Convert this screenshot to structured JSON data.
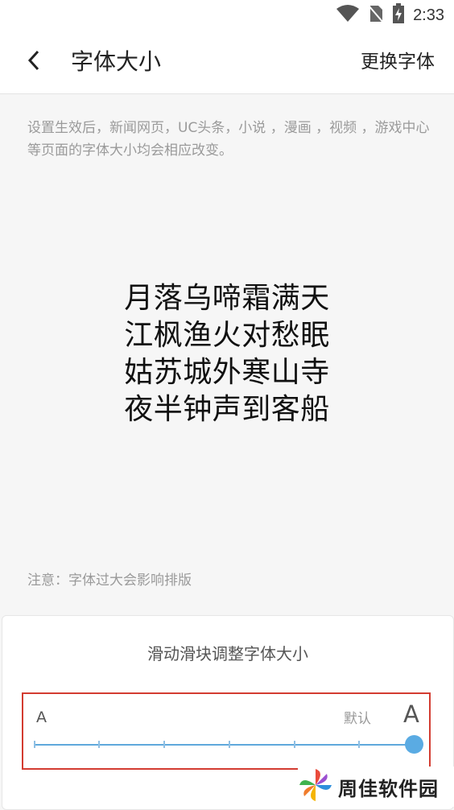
{
  "status_bar": {
    "time": "2:33",
    "icons": [
      "wifi-icon",
      "no-sim-icon",
      "battery-charging-icon"
    ]
  },
  "app_bar": {
    "back_icon": "chevron-left-icon",
    "title": "字体大小",
    "action_label": "更换字体"
  },
  "description": "设置生效后，新闻网页，UC头条，小说 ，漫画 ，视频 ，游戏中心等页面的字体大小均会相应改变。",
  "preview_poem": [
    "月落乌啼霜满天",
    "江枫渔火对愁眠",
    "姑苏城外寒山寺",
    "夜半钟声到客船"
  ],
  "note": "注意：字体过大会影响排版",
  "slider_panel": {
    "title": "滑动滑块调整字体大小",
    "small_label": "A",
    "default_label": "默认",
    "large_label": "A",
    "steps": 7,
    "selected_step": 7
  },
  "watermark": {
    "text": "周佳软件园",
    "icon": "pinwheel-logo-icon"
  },
  "colors": {
    "accent": "#5aabe3",
    "highlight_border": "#d33c31",
    "background": "#f6f6f6"
  }
}
